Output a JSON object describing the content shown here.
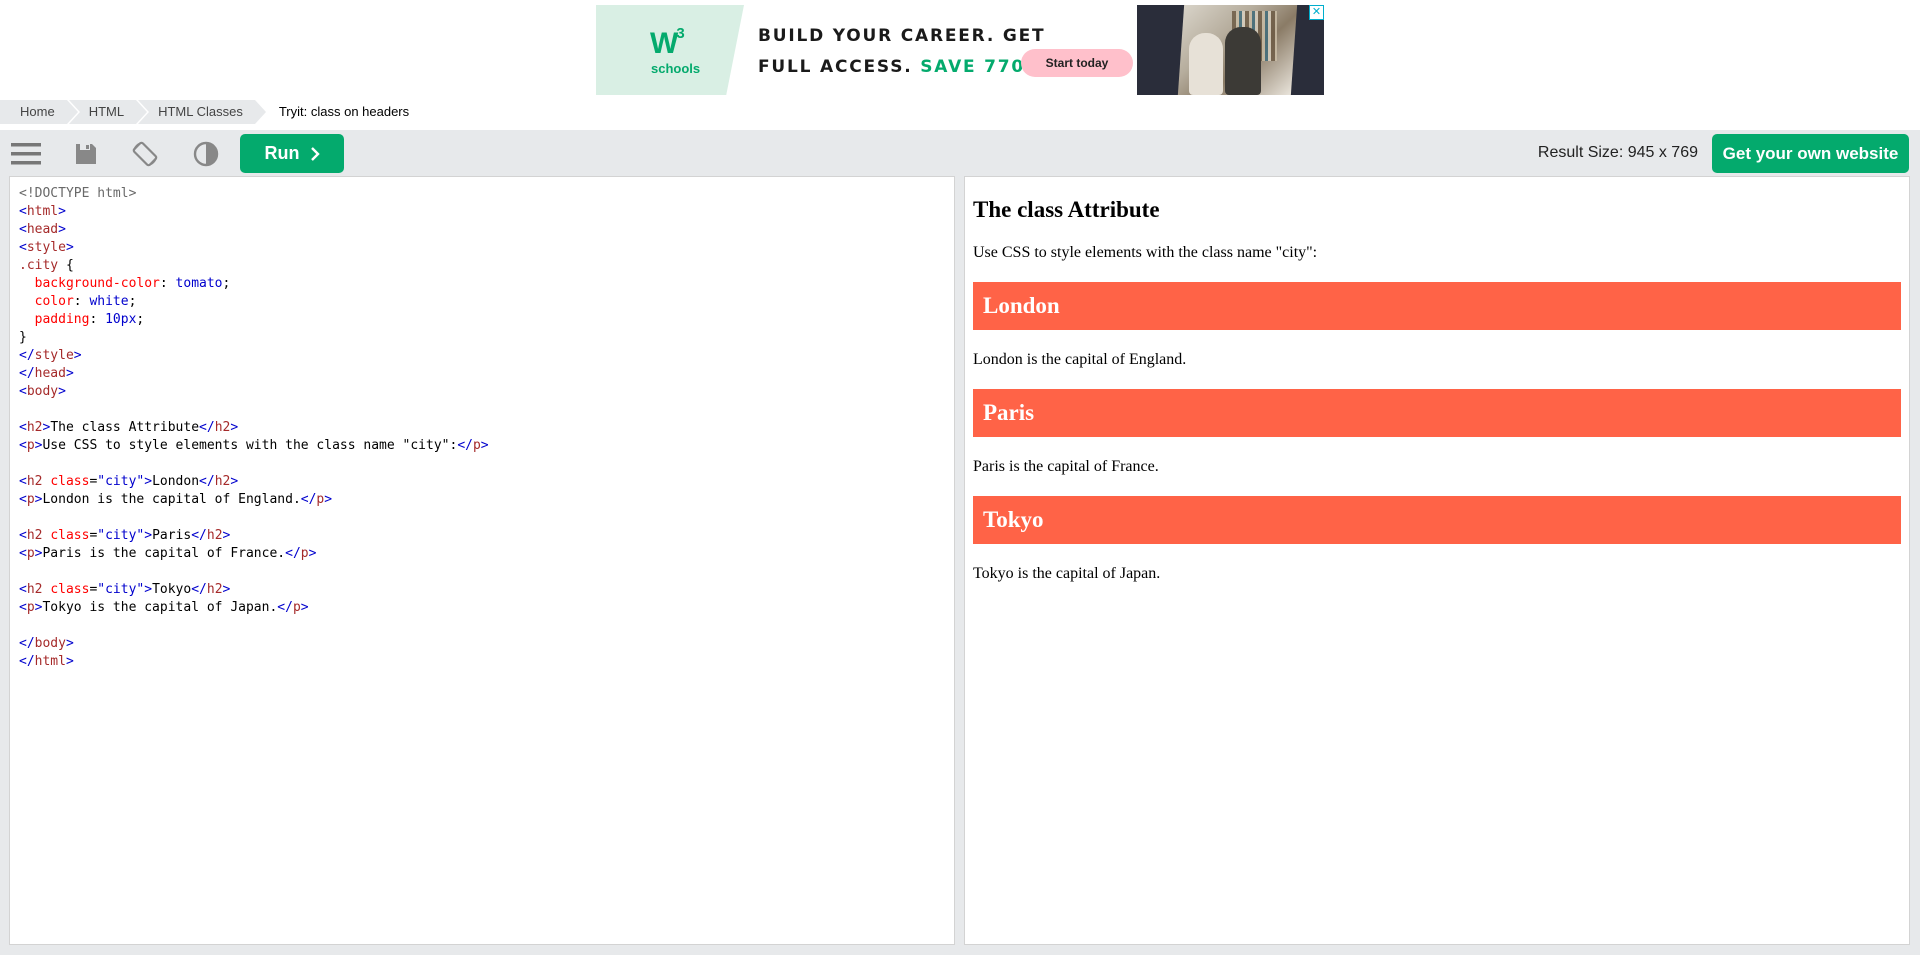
{
  "ad": {
    "logo_mark": "W",
    "logo_sup": "3",
    "logo_text": "schools",
    "headline_line1": "BUILD YOUR CAREER. GET",
    "headline_line2_prefix": "FULL ACCESS.",
    "headline_line2_accent": "SAVE 770$",
    "cta": "Start today",
    "close": "✕"
  },
  "breadcrumb": {
    "items": [
      "Home",
      "HTML",
      "HTML Classes"
    ],
    "current": "Tryit: class on headers"
  },
  "toolbar": {
    "run_label": "Run",
    "result_size": "Result Size: 945 x 769",
    "own_website": "Get your own website"
  },
  "code_lines": [
    "<!DOCTYPE html>",
    "<html>",
    "<head>",
    "<style>",
    ".city {",
    "  background-color: tomato;",
    "  color: white;",
    "  padding: 10px;",
    "}",
    "</style>",
    "</head>",
    "<body>",
    "",
    "<h2>The class Attribute</h2>",
    "<p>Use CSS to style elements with the class name \"city\":</p>",
    "",
    "<h2 class=\"city\">London</h2>",
    "<p>London is the capital of England.</p>",
    "",
    "<h2 class=\"city\">Paris</h2>",
    "<p>Paris is the capital of France.</p>",
    "",
    "<h2 class=\"city\">Tokyo</h2>",
    "<p>Tokyo is the capital of Japan.</p>",
    "",
    "</body>",
    "</html>"
  ],
  "result": {
    "title": "The class Attribute",
    "intro": "Use CSS to style elements with the class name \"city\":",
    "cities": [
      {
        "name": "London",
        "desc": "London is the capital of England."
      },
      {
        "name": "Paris",
        "desc": "Paris is the capital of France."
      },
      {
        "name": "Tokyo",
        "desc": "Tokyo is the capital of Japan."
      }
    ]
  },
  "colors": {
    "accent": "#04aa6d",
    "city_bg": "#ff6347",
    "toolbar_bg": "#e7e9eb"
  },
  "icons": [
    "menu-icon",
    "save-icon",
    "rotate-icon",
    "contrast-icon",
    "chevron-right-icon"
  ]
}
